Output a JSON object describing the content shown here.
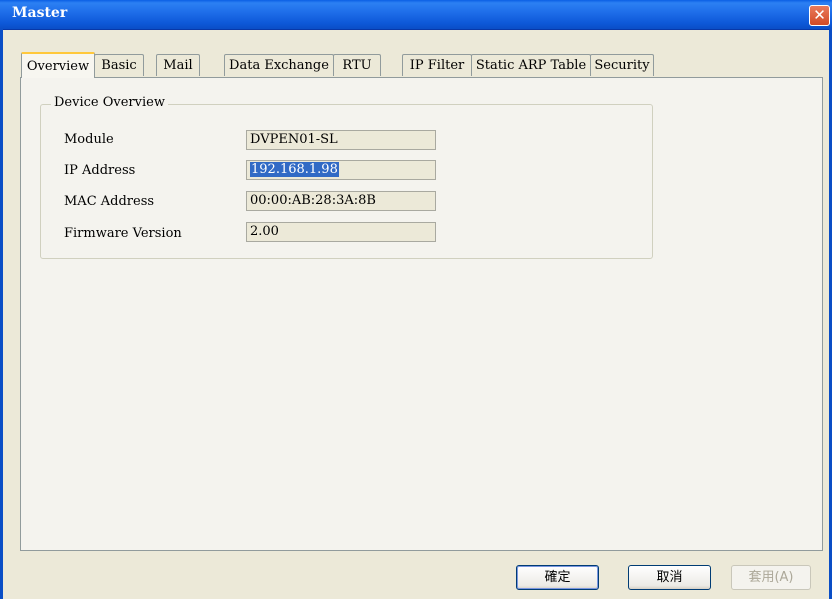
{
  "window": {
    "title": "Master",
    "close_label": "✕"
  },
  "tabs": [
    {
      "label": "Overview",
      "active": true
    },
    {
      "label": "Basic"
    },
    {
      "label": "Mail"
    },
    {
      "label": "Data Exchange"
    },
    {
      "label": "RTU"
    },
    {
      "label": "IP Filter"
    },
    {
      "label": "Static ARP Table"
    },
    {
      "label": "Security"
    }
  ],
  "overview": {
    "group_title": "Device Overview",
    "fields": [
      {
        "label": "Module",
        "value": "DVPEN01-SL"
      },
      {
        "label": "IP Address",
        "value": "192.168.1.98",
        "selected": true
      },
      {
        "label": "MAC Address",
        "value": "00:00:AB:28:3A:8B"
      },
      {
        "label": "Firmware Version",
        "value": "2.00"
      }
    ]
  },
  "buttons": {
    "ok_label": "確定",
    "cancel_label": "取消",
    "apply_label": "套用(A)"
  },
  "colors": {
    "titlebar": "#0A5FE4",
    "close_button": "#D34A25",
    "active_tab_highlight": "#FFC83C",
    "selection": "#316AC5",
    "background": "#ECE9D8"
  },
  "icons": {
    "close": "close-icon"
  }
}
